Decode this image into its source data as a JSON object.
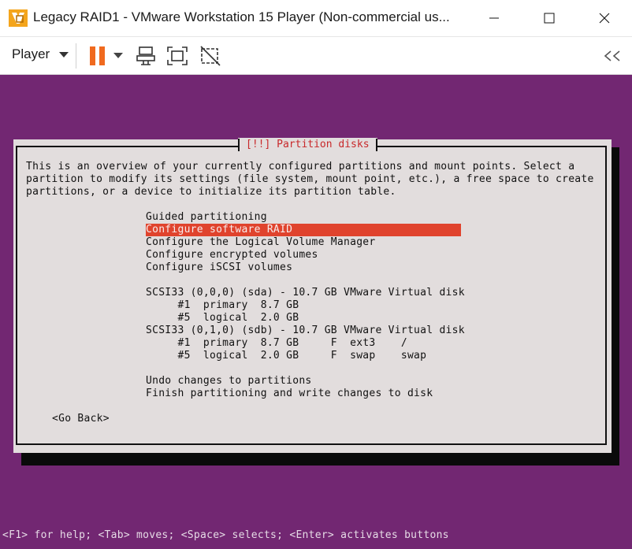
{
  "window": {
    "title": "Legacy RAID1 - VMware Workstation 15 Player (Non-commercial us...",
    "controls": [
      "minimize-icon",
      "maximize-icon",
      "close-icon"
    ]
  },
  "toolbar": {
    "player_label": "Player",
    "pause_color": "#f06a1f",
    "icons": [
      "pause-icon",
      "send-ctrl-alt-del-icon",
      "fullscreen-icon",
      "unity-icon",
      "collapse-toolbar-icon"
    ]
  },
  "installer": {
    "background_color": "#722772",
    "dialog_title": "[!!] Partition disks",
    "intro": [
      "This is an overview of your currently configured partitions and mount points. Select a",
      "partition to modify its settings (file system, mount point, etc.), a free space to create",
      "partitions, or a device to initialize its partition table."
    ],
    "menu": [
      "Guided partitioning",
      "Configure software RAID",
      "Configure the Logical Volume Manager",
      "Configure encrypted volumes",
      "Configure iSCSI volumes"
    ],
    "selected_index": 1,
    "disks": [
      "SCSI33 (0,0,0) (sda) - 10.7 GB VMware Virtual disk",
      "     #1  primary  8.7 GB",
      "     #5  logical  2.0 GB",
      "SCSI33 (0,1,0) (sdb) - 10.7 GB VMware Virtual disk",
      "     #1  primary  8.7 GB     F  ext3    /",
      "     #5  logical  2.0 GB     F  swap    swap"
    ],
    "actions": [
      "Undo changes to partitions",
      "Finish partitioning and write changes to disk"
    ],
    "go_back": "<Go Back>",
    "status": "<F1> for help; <Tab> moves; <Space> selects; <Enter> activates buttons"
  }
}
